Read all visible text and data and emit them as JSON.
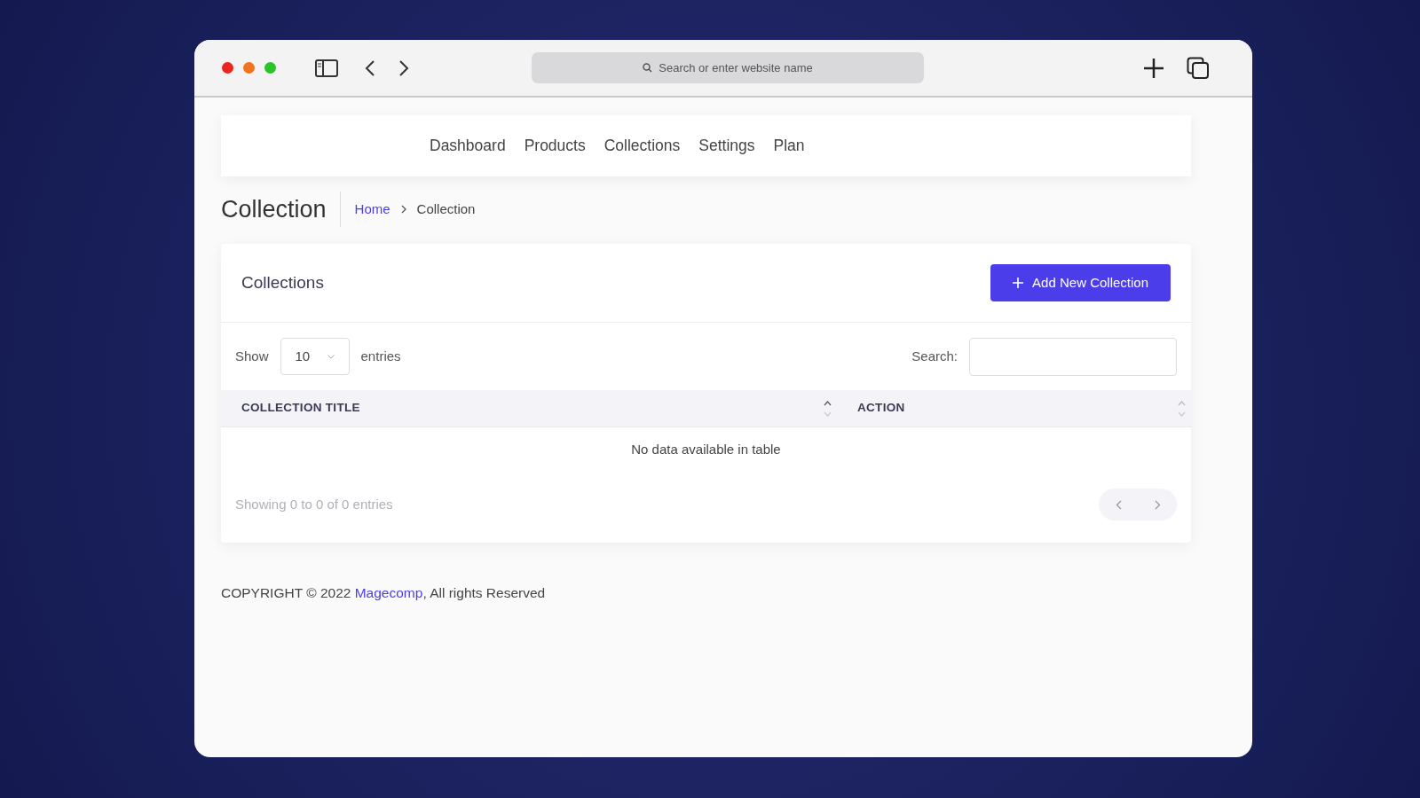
{
  "browser": {
    "address_placeholder": "Search or enter website name"
  },
  "nav": {
    "items": [
      "Dashboard",
      "Products",
      "Collections",
      "Settings",
      "Plan"
    ]
  },
  "page_header": {
    "title": "Collection",
    "breadcrumb": [
      "Home",
      "Collection"
    ]
  },
  "card": {
    "title": "Collections",
    "add_button": "Add New Collection",
    "length": {
      "before": "Show",
      "value": "10",
      "after": "entries"
    },
    "search": {
      "label": "Search:"
    },
    "table": {
      "columns": [
        "COLLECTION TITLE",
        "ACTION"
      ],
      "empty_message": "No data available in table"
    },
    "info": "Showing 0 to 0 of 0 entries"
  },
  "footer": {
    "before": "COPYRIGHT © 2022 ",
    "link": "Magecomp",
    "after": ", All rights Reserved"
  }
}
